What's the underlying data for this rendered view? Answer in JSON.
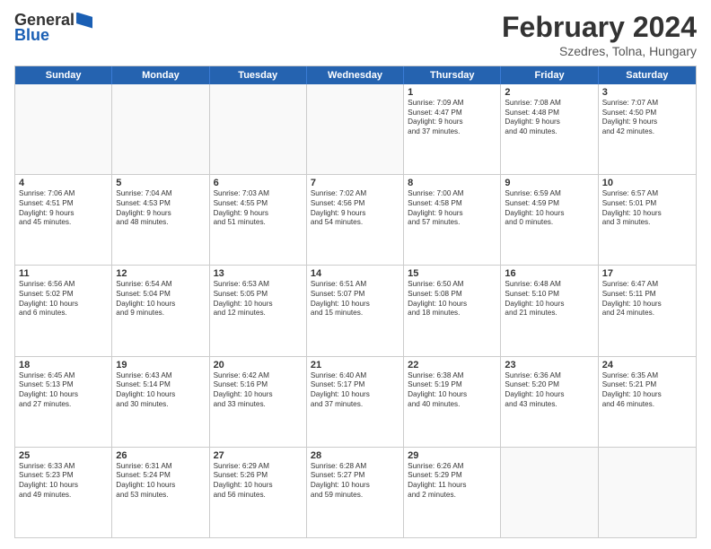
{
  "logo": {
    "general": "General",
    "blue": "Blue"
  },
  "title": {
    "month": "February 2024",
    "location": "Szedres, Tolna, Hungary"
  },
  "header": {
    "days": [
      "Sunday",
      "Monday",
      "Tuesday",
      "Wednesday",
      "Thursday",
      "Friday",
      "Saturday"
    ]
  },
  "rows": [
    [
      {
        "day": "",
        "lines": []
      },
      {
        "day": "",
        "lines": []
      },
      {
        "day": "",
        "lines": []
      },
      {
        "day": "",
        "lines": []
      },
      {
        "day": "1",
        "lines": [
          "Sunrise: 7:09 AM",
          "Sunset: 4:47 PM",
          "Daylight: 9 hours",
          "and 37 minutes."
        ]
      },
      {
        "day": "2",
        "lines": [
          "Sunrise: 7:08 AM",
          "Sunset: 4:48 PM",
          "Daylight: 9 hours",
          "and 40 minutes."
        ]
      },
      {
        "day": "3",
        "lines": [
          "Sunrise: 7:07 AM",
          "Sunset: 4:50 PM",
          "Daylight: 9 hours",
          "and 42 minutes."
        ]
      }
    ],
    [
      {
        "day": "4",
        "lines": [
          "Sunrise: 7:06 AM",
          "Sunset: 4:51 PM",
          "Daylight: 9 hours",
          "and 45 minutes."
        ]
      },
      {
        "day": "5",
        "lines": [
          "Sunrise: 7:04 AM",
          "Sunset: 4:53 PM",
          "Daylight: 9 hours",
          "and 48 minutes."
        ]
      },
      {
        "day": "6",
        "lines": [
          "Sunrise: 7:03 AM",
          "Sunset: 4:55 PM",
          "Daylight: 9 hours",
          "and 51 minutes."
        ]
      },
      {
        "day": "7",
        "lines": [
          "Sunrise: 7:02 AM",
          "Sunset: 4:56 PM",
          "Daylight: 9 hours",
          "and 54 minutes."
        ]
      },
      {
        "day": "8",
        "lines": [
          "Sunrise: 7:00 AM",
          "Sunset: 4:58 PM",
          "Daylight: 9 hours",
          "and 57 minutes."
        ]
      },
      {
        "day": "9",
        "lines": [
          "Sunrise: 6:59 AM",
          "Sunset: 4:59 PM",
          "Daylight: 10 hours",
          "and 0 minutes."
        ]
      },
      {
        "day": "10",
        "lines": [
          "Sunrise: 6:57 AM",
          "Sunset: 5:01 PM",
          "Daylight: 10 hours",
          "and 3 minutes."
        ]
      }
    ],
    [
      {
        "day": "11",
        "lines": [
          "Sunrise: 6:56 AM",
          "Sunset: 5:02 PM",
          "Daylight: 10 hours",
          "and 6 minutes."
        ]
      },
      {
        "day": "12",
        "lines": [
          "Sunrise: 6:54 AM",
          "Sunset: 5:04 PM",
          "Daylight: 10 hours",
          "and 9 minutes."
        ]
      },
      {
        "day": "13",
        "lines": [
          "Sunrise: 6:53 AM",
          "Sunset: 5:05 PM",
          "Daylight: 10 hours",
          "and 12 minutes."
        ]
      },
      {
        "day": "14",
        "lines": [
          "Sunrise: 6:51 AM",
          "Sunset: 5:07 PM",
          "Daylight: 10 hours",
          "and 15 minutes."
        ]
      },
      {
        "day": "15",
        "lines": [
          "Sunrise: 6:50 AM",
          "Sunset: 5:08 PM",
          "Daylight: 10 hours",
          "and 18 minutes."
        ]
      },
      {
        "day": "16",
        "lines": [
          "Sunrise: 6:48 AM",
          "Sunset: 5:10 PM",
          "Daylight: 10 hours",
          "and 21 minutes."
        ]
      },
      {
        "day": "17",
        "lines": [
          "Sunrise: 6:47 AM",
          "Sunset: 5:11 PM",
          "Daylight: 10 hours",
          "and 24 minutes."
        ]
      }
    ],
    [
      {
        "day": "18",
        "lines": [
          "Sunrise: 6:45 AM",
          "Sunset: 5:13 PM",
          "Daylight: 10 hours",
          "and 27 minutes."
        ]
      },
      {
        "day": "19",
        "lines": [
          "Sunrise: 6:43 AM",
          "Sunset: 5:14 PM",
          "Daylight: 10 hours",
          "and 30 minutes."
        ]
      },
      {
        "day": "20",
        "lines": [
          "Sunrise: 6:42 AM",
          "Sunset: 5:16 PM",
          "Daylight: 10 hours",
          "and 33 minutes."
        ]
      },
      {
        "day": "21",
        "lines": [
          "Sunrise: 6:40 AM",
          "Sunset: 5:17 PM",
          "Daylight: 10 hours",
          "and 37 minutes."
        ]
      },
      {
        "day": "22",
        "lines": [
          "Sunrise: 6:38 AM",
          "Sunset: 5:19 PM",
          "Daylight: 10 hours",
          "and 40 minutes."
        ]
      },
      {
        "day": "23",
        "lines": [
          "Sunrise: 6:36 AM",
          "Sunset: 5:20 PM",
          "Daylight: 10 hours",
          "and 43 minutes."
        ]
      },
      {
        "day": "24",
        "lines": [
          "Sunrise: 6:35 AM",
          "Sunset: 5:21 PM",
          "Daylight: 10 hours",
          "and 46 minutes."
        ]
      }
    ],
    [
      {
        "day": "25",
        "lines": [
          "Sunrise: 6:33 AM",
          "Sunset: 5:23 PM",
          "Daylight: 10 hours",
          "and 49 minutes."
        ]
      },
      {
        "day": "26",
        "lines": [
          "Sunrise: 6:31 AM",
          "Sunset: 5:24 PM",
          "Daylight: 10 hours",
          "and 53 minutes."
        ]
      },
      {
        "day": "27",
        "lines": [
          "Sunrise: 6:29 AM",
          "Sunset: 5:26 PM",
          "Daylight: 10 hours",
          "and 56 minutes."
        ]
      },
      {
        "day": "28",
        "lines": [
          "Sunrise: 6:28 AM",
          "Sunset: 5:27 PM",
          "Daylight: 10 hours",
          "and 59 minutes."
        ]
      },
      {
        "day": "29",
        "lines": [
          "Sunrise: 6:26 AM",
          "Sunset: 5:29 PM",
          "Daylight: 11 hours",
          "and 2 minutes."
        ]
      },
      {
        "day": "",
        "lines": []
      },
      {
        "day": "",
        "lines": []
      }
    ]
  ]
}
